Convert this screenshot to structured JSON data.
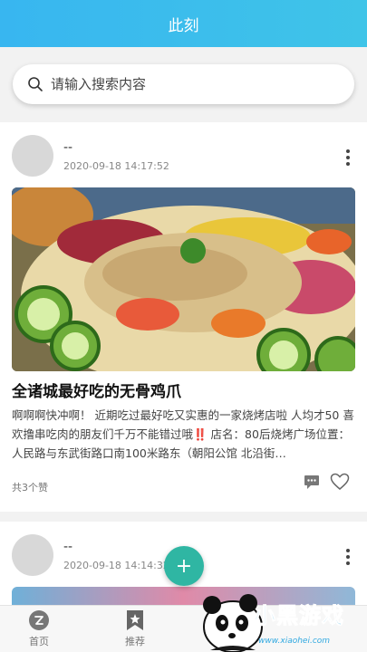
{
  "header": {
    "title": "此刻"
  },
  "search": {
    "placeholder": "请输入搜索内容",
    "icon": "search-icon"
  },
  "posts": [
    {
      "author": "--",
      "time": "2020-09-18 14:17:52",
      "title": "全诸城最好吃的无骨鸡爪",
      "description": "啊啊啊快冲啊！ 近期吃过最好吃又实惠的一家烧烤店啦 人均才50 喜欢撸串吃肉的朋友们千万不能错过哦‼️ 店名：80后烧烤广场位置：人民路与东武街路口南100米路东（朝阳公馆 北沿街…",
      "likes": "共3个赞"
    },
    {
      "author": "--",
      "time": "2020-09-18 14:14:32"
    }
  ],
  "fab": {
    "label": "+"
  },
  "tabs": [
    {
      "label": "首页",
      "icon": "home-icon"
    },
    {
      "label": "推荐",
      "icon": "bookmark-icon"
    }
  ],
  "watermark": {
    "text": "小黑游戏",
    "url": "www.xiaohei.com"
  },
  "colors": {
    "header": "#38b6f0",
    "fab": "#2fb6a3",
    "watermark": "#2fa8e0"
  }
}
